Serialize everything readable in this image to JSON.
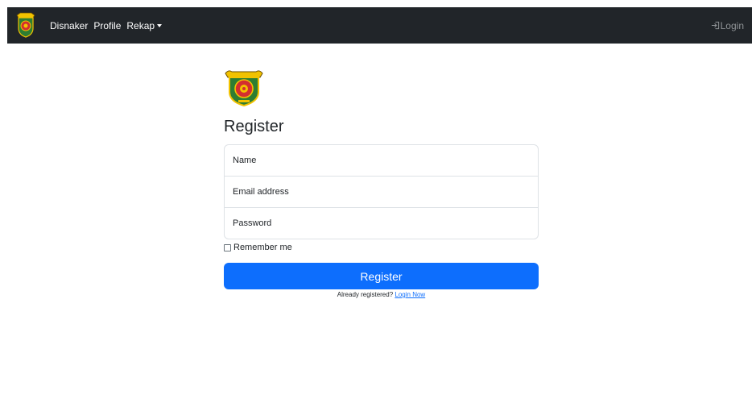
{
  "navbar": {
    "logo_icon": "regency-crest-icon",
    "links": [
      {
        "label": "Disnaker"
      },
      {
        "label": "Profile"
      },
      {
        "label": "Rekap"
      }
    ],
    "login": {
      "label": "Login",
      "icon": "login-arrow-icon"
    }
  },
  "form": {
    "logo_icon": "regency-crest-icon",
    "title": "Register",
    "fields": {
      "name_placeholder": "Name",
      "email_placeholder": "Email address",
      "password_placeholder": "Password"
    },
    "remember_label": "Remember me",
    "remember_checked": false,
    "submit_label": "Register",
    "already_text": "Already registered?",
    "login_link": "Login Now"
  },
  "colors": {
    "navbar_bg": "#212529",
    "primary": "#0d6efd",
    "logo_green": "#2e7d32",
    "logo_red": "#d32f2f",
    "logo_yellow": "#f2c200"
  }
}
